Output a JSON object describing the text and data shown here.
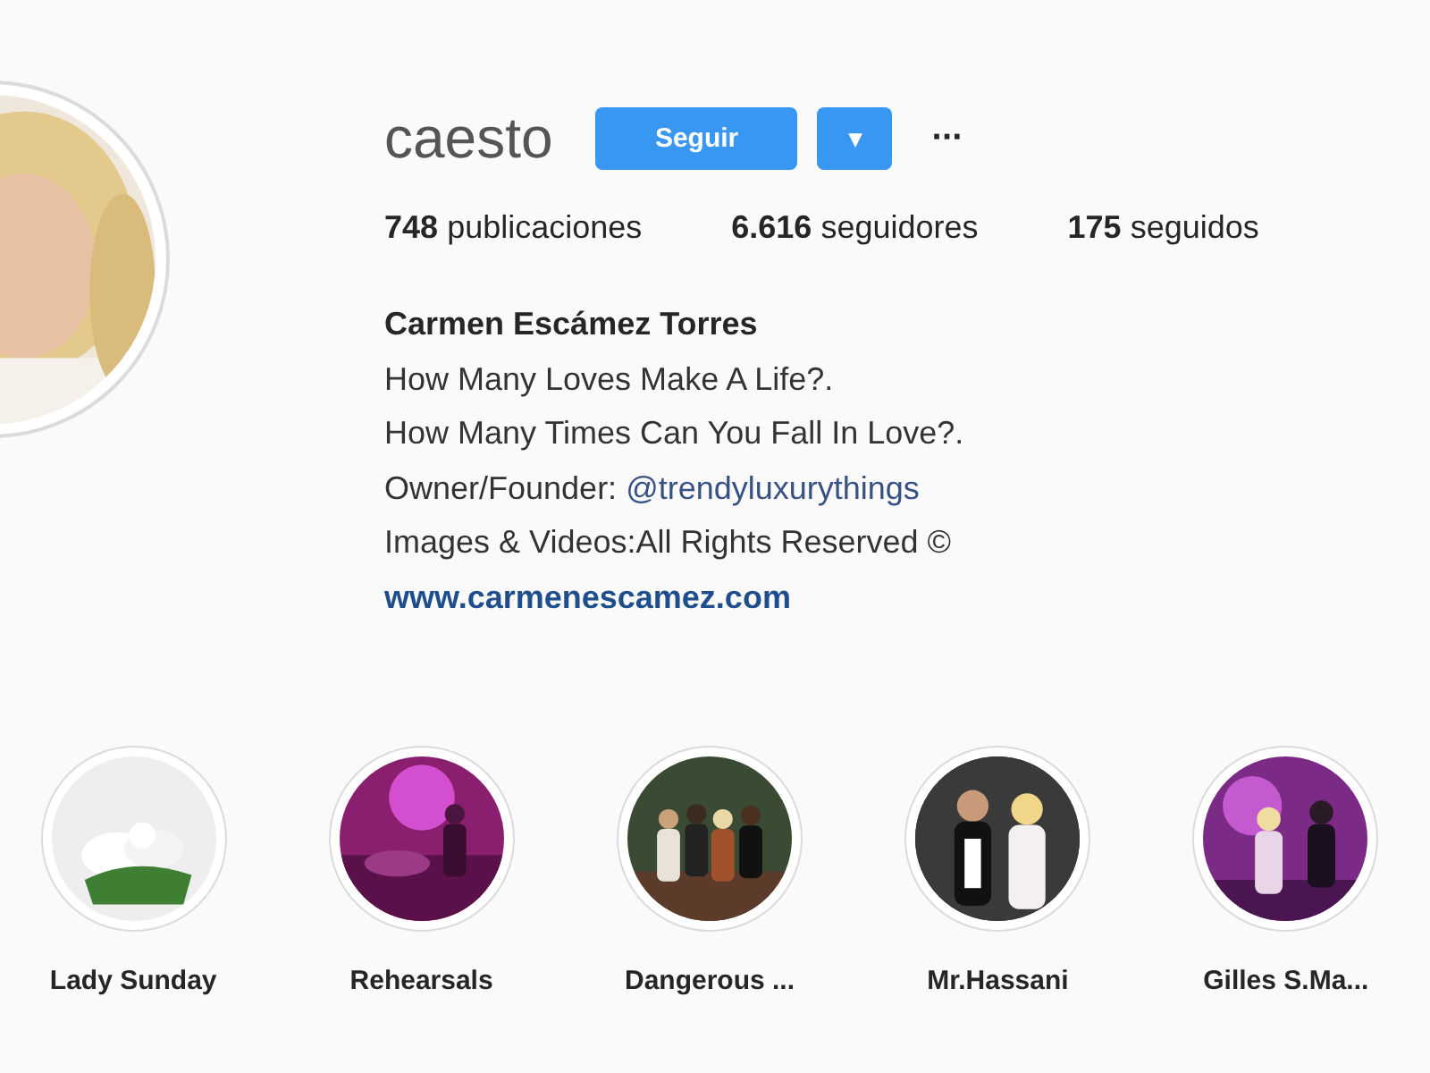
{
  "profile": {
    "username": "caesto",
    "follow_button": "Seguir",
    "dropdown_button": "▾",
    "more_button": "···",
    "stats": [
      {
        "count": "748",
        "label": "publicaciones"
      },
      {
        "count": "6.616",
        "label": "seguidores"
      },
      {
        "count": "175",
        "label": "seguidos"
      }
    ],
    "full_name": "Carmen Escámez Torres",
    "bio_lines": [
      {
        "kind": "text",
        "text": "How Many Loves Make A Life?."
      },
      {
        "kind": "text",
        "text": "How Many Times Can You Fall In Love?."
      },
      {
        "kind": "mention",
        "text": "Owner/Founder: ",
        "link": "@trendyluxurythings"
      },
      {
        "kind": "text",
        "text": "Images & Videos:All Rights Reserved ©"
      }
    ],
    "website": "www.carmenescamez.com"
  },
  "highlights": [
    {
      "label": "Lady Sunday"
    },
    {
      "label": "Rehearsals"
    },
    {
      "label": "Dangerous ..."
    },
    {
      "label": "Mr.Hassani"
    },
    {
      "label": "Gilles S.Ma..."
    }
  ]
}
